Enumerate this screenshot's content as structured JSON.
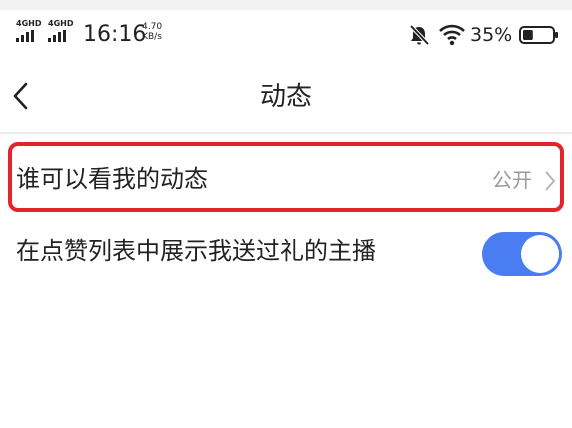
{
  "status_bar": {
    "signal1_tag": "4GHD",
    "signal2_tag": "4GHD",
    "time": "16:16",
    "net_speed_value": "4.70",
    "net_speed_unit": "KB/s",
    "battery_percent": "35%",
    "battery_level": 0.35,
    "icons": [
      "signal-icon",
      "signal-icon",
      "mute-bell-icon",
      "wifi-icon",
      "battery-icon"
    ]
  },
  "nav": {
    "back_icon": "chevron-left-icon",
    "title": "动态"
  },
  "settings": {
    "who_can_see": {
      "label": "谁可以看我的动态",
      "value": "公开"
    },
    "show_gift_anchors": {
      "label": "在点赞列表中展示我送过礼的主播",
      "enabled": true
    }
  },
  "colors": {
    "toggle_on": "#4a7cf2",
    "highlight_border": "#e3242b",
    "value_text": "#9a9a9a"
  }
}
